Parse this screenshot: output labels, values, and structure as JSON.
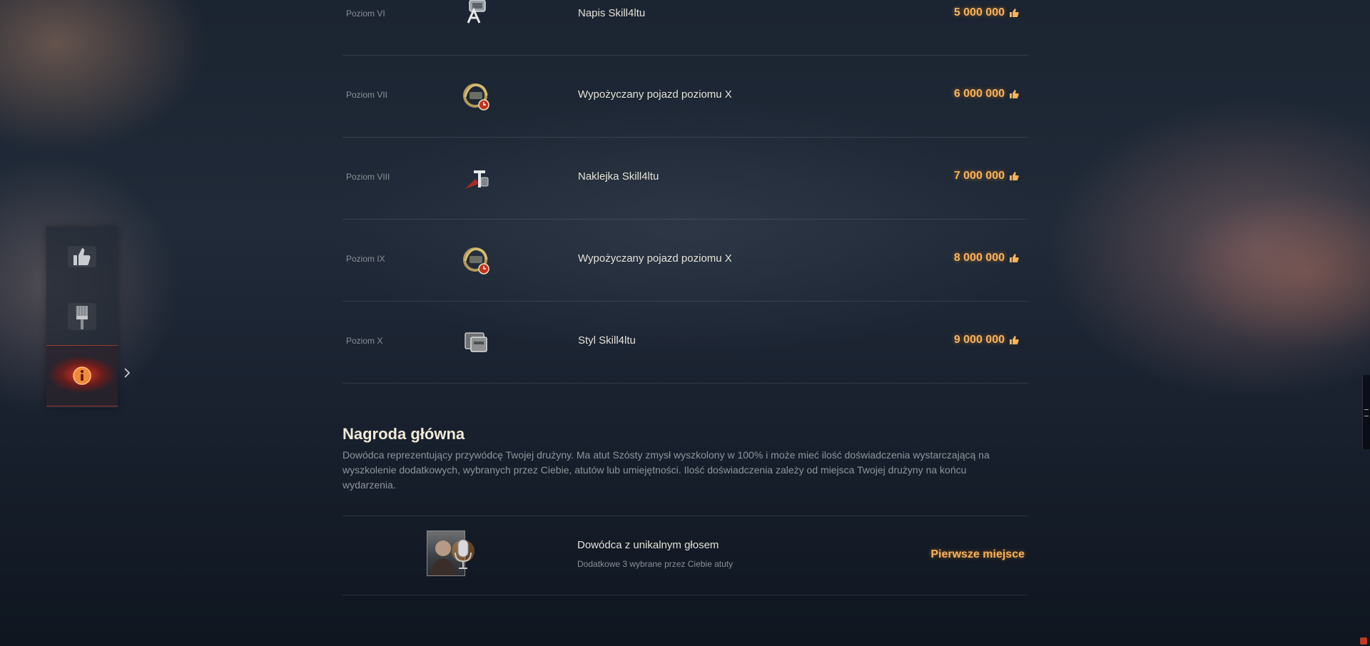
{
  "tiers": [
    {
      "level": "Poziom VI",
      "reward": "Napis Skill4ltu",
      "points": "5 000 000",
      "icon": "inscription-icon"
    },
    {
      "level": "Poziom VII",
      "reward": "Wypożyczany pojazd poziomu X",
      "points": "6 000 000",
      "icon": "rental-vehicle-icon"
    },
    {
      "level": "Poziom VIII",
      "reward": "Naklejka Skill4ltu",
      "points": "7 000 000",
      "icon": "decal-icon"
    },
    {
      "level": "Poziom IX",
      "reward": "Wypożyczany pojazd poziomu X",
      "points": "8 000 000",
      "icon": "rental-vehicle-icon"
    },
    {
      "level": "Poziom X",
      "reward": "Styl Skill4ltu",
      "points": "9 000 000",
      "icon": "style-icon"
    }
  ],
  "main_prize": {
    "title": "Nagroda główna",
    "description": "Dowódca reprezentujący przywódcę Twojej drużyny. Ma atut Szósty zmysł wyszkolony w 100% i może mieć ilość doświadczenia wystarczającą na wyszkolenie dodatkowych, wybranych przez Ciebie, atutów lub umiejętności. Ilość doświadczenia zależy od miejsca Twojej drużyny na końcu wydarzenia.",
    "reward_title": "Dowódca z unikalnym głosem",
    "reward_subtitle": "Dodatkowe 3 wybrane przez Ciebie atuty",
    "place": "Pierwsze miejsce"
  },
  "sidebar": {
    "items": [
      {
        "icon": "thumbs-up-icon",
        "active": false
      },
      {
        "icon": "brush-icon",
        "active": false
      },
      {
        "icon": "info-icon",
        "active": true
      }
    ]
  },
  "colors": {
    "accent": "#f7b25a",
    "active_red": "#d8361c",
    "background": "#1b2431"
  }
}
